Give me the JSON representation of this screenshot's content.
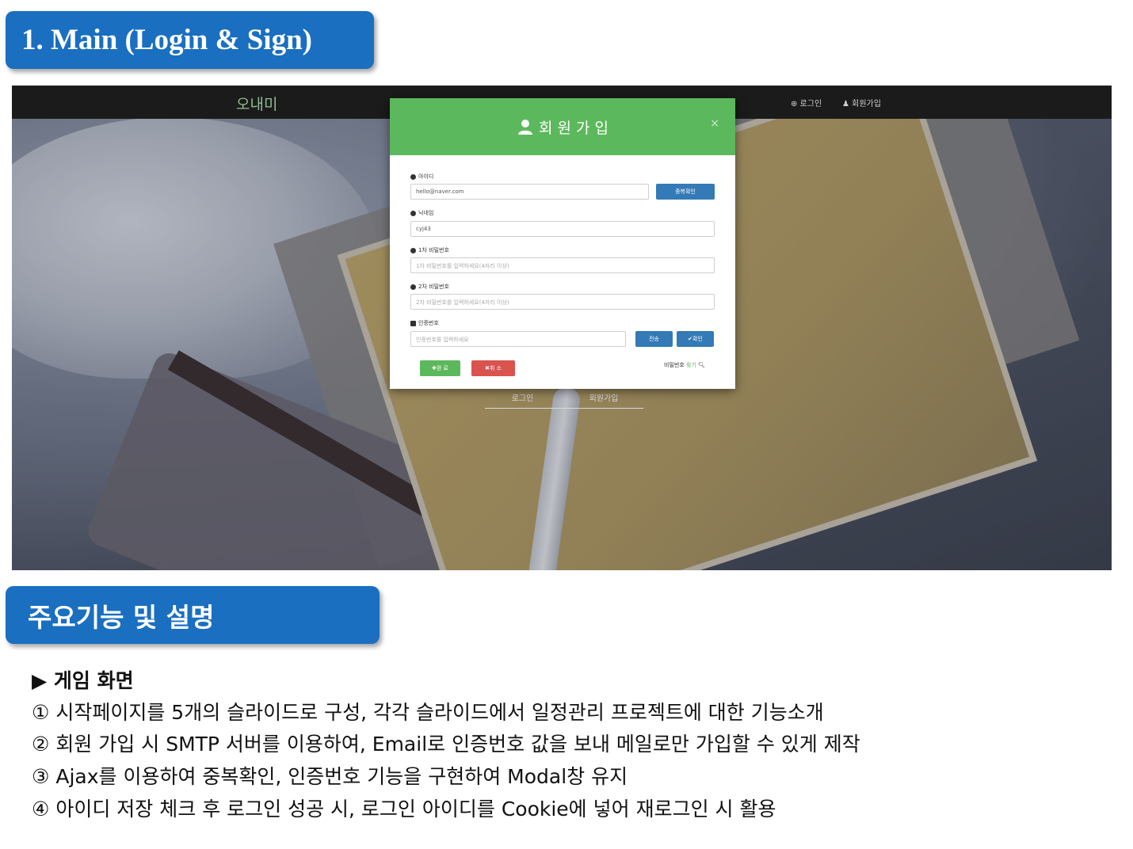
{
  "section1": {
    "title": "1. Main (Login & Sign)"
  },
  "screenshot": {
    "navbar": {
      "brand": "오내미",
      "login_link": "⊕ 로그인",
      "signup_link": "♟ 회원가입"
    },
    "behind_buttons": {
      "login": "로그인",
      "signup": "회원가입"
    },
    "modal": {
      "title": "회 원 가 입",
      "close": "×",
      "fields": {
        "id": {
          "label": "아이디",
          "value": "hello@naver.com",
          "check_button": "중복확인"
        },
        "nickname": {
          "label": "닉네임",
          "value": "cyj43"
        },
        "password1": {
          "label": "1차 비밀번호",
          "placeholder": "1차 비밀번호를 입력하세요(4자리 이상)"
        },
        "password2": {
          "label": "2차 비밀번호",
          "placeholder": "2차 비밀번호를 입력하세요(4자리 이상)"
        },
        "auth_code": {
          "label": "인증번호",
          "placeholder": "인증번호를 입력하세요",
          "send_button": "전송",
          "confirm_button": "✔확인"
        }
      },
      "submit_button": "✚완 료",
      "cancel_button": "✖취 소",
      "find_password": {
        "text": "비밀번호 ",
        "link": "찾기"
      }
    },
    "colors": {
      "header_green": "#5cb85c",
      "button_blue": "#337ab7",
      "button_red": "#d9534f",
      "navbar": "#1b1b1b"
    }
  },
  "section2": {
    "title": "주요기능 및 설명"
  },
  "description": {
    "heading": "▶ 게임 화면",
    "items": [
      "① 시작페이지를 5개의 슬라이드로 구성, 각각 슬라이드에서 일정관리 프로젝트에 대한 기능소개",
      "② 회원 가입 시 SMTP 서버를 이용하여, Email로 인증번호 값을 보내 메일로만 가입할 수 있게 제작",
      "③ Ajax를 이용하여 중복확인, 인증번호 기능을 구현하여 Modal창 유지",
      "④ 아이디 저장 체크 후 로그인 성공 시, 로그인 아이디를 Cookie에 넣어 재로그인 시 활용"
    ]
  },
  "tab_color": "#1a6fc0"
}
